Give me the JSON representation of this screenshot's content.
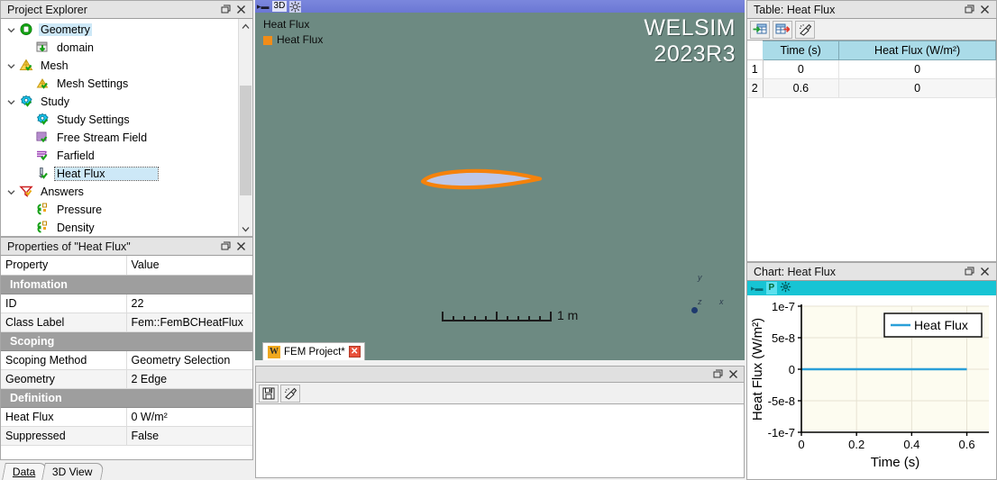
{
  "project_explorer": {
    "title": "Project Explorer",
    "items": [
      {
        "label": "Geometry",
        "icon": "geometry-icon",
        "depth": 0,
        "expander": "chevron-down-icon",
        "state": "selected-soft"
      },
      {
        "label": "domain",
        "icon": "domain-icon",
        "depth": 1,
        "expander": "none",
        "state": "normal"
      },
      {
        "label": "Mesh",
        "icon": "mesh-icon",
        "depth": 0,
        "expander": "chevron-down-icon",
        "state": "normal"
      },
      {
        "label": "Mesh Settings",
        "icon": "mesh-settings-icon",
        "depth": 1,
        "expander": "none",
        "state": "normal"
      },
      {
        "label": "Study",
        "icon": "study-icon",
        "depth": 0,
        "expander": "chevron-down-icon",
        "state": "normal"
      },
      {
        "label": "Study Settings",
        "icon": "study-settings-icon",
        "depth": 1,
        "expander": "none",
        "state": "normal"
      },
      {
        "label": "Free Stream Field",
        "icon": "free-stream-icon",
        "depth": 1,
        "expander": "none",
        "state": "normal"
      },
      {
        "label": "Farfield",
        "icon": "farfield-icon",
        "depth": 1,
        "expander": "none",
        "state": "normal"
      },
      {
        "label": "Heat Flux",
        "icon": "heat-flux-icon",
        "depth": 1,
        "expander": "none",
        "state": "selected-hard"
      },
      {
        "label": "Answers",
        "icon": "answers-icon",
        "depth": 0,
        "expander": "chevron-down-icon",
        "state": "normal"
      },
      {
        "label": "Pressure",
        "icon": "result-icon",
        "depth": 1,
        "expander": "none",
        "state": "normal"
      },
      {
        "label": "Density",
        "icon": "result-icon",
        "depth": 1,
        "expander": "none",
        "state": "normal"
      }
    ],
    "scroll_up_icon": "chevron-up-icon",
    "scroll_down_icon": "chevron-down-icon"
  },
  "properties": {
    "title": "Properties of \"Heat Flux\"",
    "header": {
      "property": "Property",
      "value": "Value"
    },
    "rows": [
      {
        "kind": "group",
        "name": "Infomation",
        "value": ""
      },
      {
        "kind": "item",
        "name": "ID",
        "value": "22"
      },
      {
        "kind": "item",
        "name": "Class Label",
        "value": "Fem::FemBCHeatFlux"
      },
      {
        "kind": "group",
        "name": "Scoping",
        "value": ""
      },
      {
        "kind": "item",
        "name": "Scoping Method",
        "value": "Geometry Selection"
      },
      {
        "kind": "item",
        "name": "Geometry",
        "value": "2 Edge"
      },
      {
        "kind": "group",
        "name": "Definition",
        "value": ""
      },
      {
        "kind": "item",
        "name": "Heat Flux",
        "value": "0 W/m²"
      },
      {
        "kind": "item",
        "name": "Suppressed",
        "value": "False"
      }
    ],
    "tabs": [
      {
        "label": "Data",
        "active": true
      },
      {
        "label": "3D View",
        "active": false
      }
    ]
  },
  "viewport": {
    "title": "3D",
    "title_pin_icon": "pin-icon",
    "title_gear_icon": "gear-icon",
    "legend_title": "Heat Flux",
    "legend_entry": "Heat Flux",
    "legend_swatch_color": "#f28c17",
    "watermark_line1": "WELSIM",
    "watermark_line2": "2023R3",
    "scale_label": "1 m",
    "background_color": "#6d8a82",
    "geometry_outline_color": "#f5820b",
    "geometry_fill_color": "#bdc7e8",
    "axes": {
      "x": "x",
      "y": "y",
      "z": "z"
    },
    "tabs": [
      {
        "label": "FEM Project*",
        "logo": "W",
        "close_icon": "close-icon",
        "active": true
      }
    ]
  },
  "output_panel": {
    "title": "",
    "toolbar": [
      {
        "icon": "save-icon",
        "name": "save-output-button"
      },
      {
        "icon": "clear-icon",
        "name": "clear-output-button"
      }
    ],
    "content": ""
  },
  "table_panel": {
    "title": "Table: Heat Flux",
    "toolbar": [
      {
        "icon": "import-table-icon",
        "name": "import-table-button"
      },
      {
        "icon": "export-table-icon",
        "name": "export-table-button"
      },
      {
        "icon": "clear-table-icon",
        "name": "clear-table-button"
      }
    ],
    "columns": [
      "Time (s)",
      "Heat Flux (W/m²)"
    ],
    "rows": [
      {
        "n": "1",
        "cells": [
          "0",
          "0"
        ]
      },
      {
        "n": "2",
        "cells": [
          "0.6",
          "0"
        ]
      }
    ]
  },
  "chart_panel": {
    "title": "Chart: Heat Flux",
    "toolbar": {
      "grip_icon": "grip-icon",
      "p_label": "P",
      "settings_icon": "gear-icon"
    }
  },
  "chart_data": {
    "type": "line",
    "title": "",
    "xlabel": "Time (s)",
    "ylabel": "Heat Flux (W/m²)",
    "xlim": [
      0,
      0.68
    ],
    "ylim": [
      -1e-07,
      1e-07
    ],
    "xticks": [
      0,
      0.2,
      0.4,
      0.6
    ],
    "xticklabels": [
      "0",
      "0.2",
      "0.4",
      "0.6"
    ],
    "yticks": [
      -1e-07,
      -5e-08,
      0,
      5e-08,
      1e-07
    ],
    "yticklabels": [
      "-1e-7",
      "-5e-8",
      "0",
      "5e-8",
      "1e-7"
    ],
    "grid": true,
    "legend_position": "upper right",
    "plot_background": "#fdfcf0",
    "series": [
      {
        "name": "Heat Flux",
        "color": "#2a9fd8",
        "x": [
          0,
          0.6
        ],
        "y": [
          0,
          0
        ]
      }
    ]
  }
}
